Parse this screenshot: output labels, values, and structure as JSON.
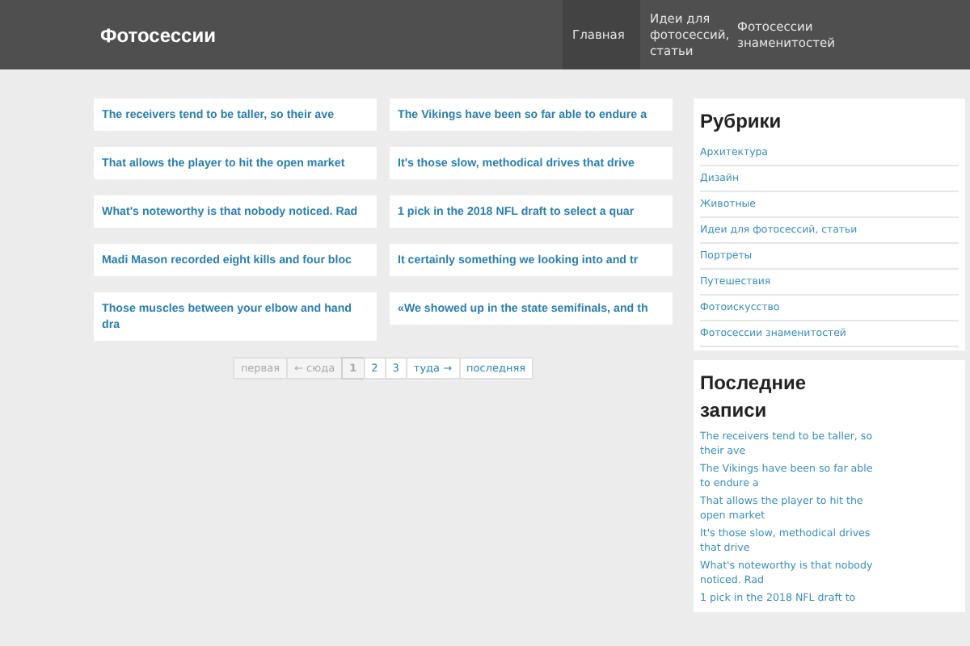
{
  "header": {
    "site_title": "Фотосессии",
    "nav": [
      {
        "label": "Главная",
        "selected": true
      },
      {
        "label": "Идеи для фотосессий, статьи",
        "selected": false
      },
      {
        "label": "Фотосессии знаменитостей",
        "selected": false
      }
    ]
  },
  "posts": {
    "columns": [
      [
        "The receivers tend to be taller, so their ave",
        "That allows the player to hit the open market",
        "What's noteworthy is that nobody noticed. Rad",
        "Madi Mason recorded eight kills and four bloc",
        "Those muscles between your elbow and hand dra"
      ],
      [
        "The Vikings have been so far able to endure a",
        "It's those slow, methodical drives that drive",
        "1 pick in the 2018 NFL draft to select a quar",
        "It certainly something we looking into and tr",
        "«We showed up in the state semifinals, and th"
      ]
    ]
  },
  "pagination": [
    {
      "label": "первая",
      "disabled": true,
      "selected": false
    },
    {
      "label": "← сюда",
      "disabled": true,
      "selected": false
    },
    {
      "label": "1",
      "disabled": false,
      "selected": true
    },
    {
      "label": "2",
      "disabled": false,
      "selected": false
    },
    {
      "label": "3",
      "disabled": false,
      "selected": false
    },
    {
      "label": "туда →",
      "disabled": false,
      "selected": false
    },
    {
      "label": "последняя",
      "disabled": false,
      "selected": false
    }
  ],
  "sidebar": {
    "categories": {
      "title": "Рубрики",
      "items": [
        "Архитектура",
        "Дизайн",
        "Животные",
        "Идеи для фотосессий, статьи",
        "Портреты",
        "Путешествия",
        "Фотоискусство",
        "Фотосессии знаменитостей"
      ]
    },
    "recent": {
      "title": "Последние записи",
      "items": [
        "The receivers tend to be taller, so their ave",
        "The Vikings have been so far able to endure a",
        "That allows the player to hit the open market",
        "It's those slow, methodical drives that drive",
        "What's noteworthy is that nobody noticed. Rad",
        "1 pick in the 2018 NFL draft to"
      ]
    }
  }
}
